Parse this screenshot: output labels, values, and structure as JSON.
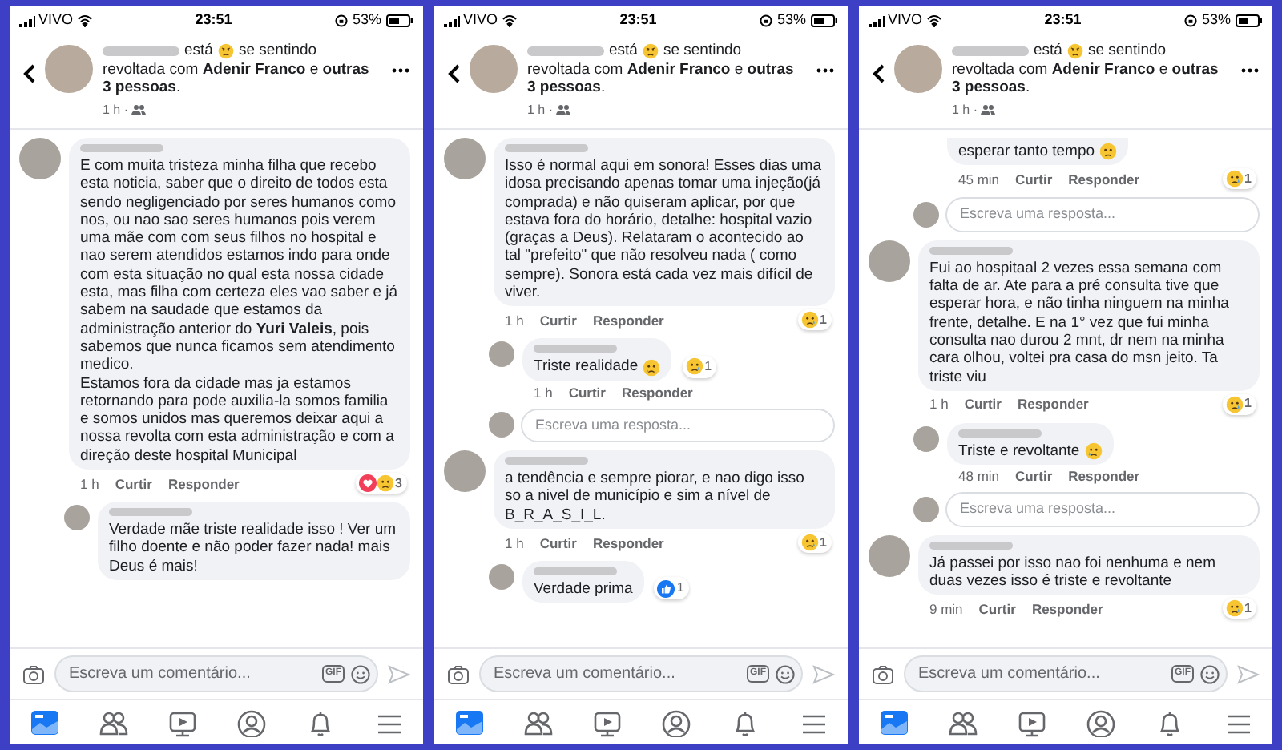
{
  "panels": [
    {
      "status_bar": {
        "carrier": "VIVO",
        "time": "23:51",
        "battery": "53%"
      },
      "post_header": {
        "status": "está",
        "feeling_start": "se sentindo",
        "feeling": "revoltada com **Adenir Franco** e **outras 3 pessoas**.",
        "time": "1 h ·"
      },
      "comments": [
        {
          "kind": "comment",
          "text": "E com muita tristeza minha filha que recebo esta noticia, saber que o direito de todos esta sendo negligenciado por seres humanos  como nos, ou nao sao seres humanos pois verem uma mãe  com com seus filhos no hospital e nao serem atendidos estamos indo para onde com esta situação no qual esta nossa cidade esta, mas filha com certeza eles vao saber e já sabem  na saudade que estamos  da administração  anterior do **Yuri Valeis**, pois sabemos que nunca ficamos sem atendimento  medico.\nEstamos fora da cidade  mas ja estamos retornando  para pode auxilia-la somos familia e somos unidos mas queremos deixar aqui a nossa revolta com esta administração  e com a direção  deste hospital  Municipal",
          "time": "1 h",
          "like": "Curtir",
          "reply": "Responder",
          "reactions": [
            {
              "kind": "love"
            },
            {
              "kind": "sad"
            }
          ],
          "reaction_count": "3"
        },
        {
          "kind": "reply",
          "text": "Verdade mãe  triste realidade isso ! Ver um filho doente e não poder fazer nada! mais Deus é mais!"
        }
      ],
      "composer": {
        "placeholder": "Escreva um comentário...",
        "gif": "GIF"
      },
      "nav": [
        {
          "kind": "feed",
          "selected": true
        },
        {
          "kind": "friends",
          "selected": false
        },
        {
          "kind": "watch",
          "selected": false
        },
        {
          "kind": "profile",
          "selected": false
        },
        {
          "kind": "bell",
          "selected": false
        },
        {
          "kind": "menu",
          "selected": false
        }
      ]
    },
    {
      "status_bar": {
        "carrier": "VIVO",
        "time": "23:51",
        "battery": "53%"
      },
      "post_header": {
        "status": "está",
        "feeling_start": "se sentindo",
        "feeling": "revoltada com **Adenir Franco** e **outras 3 pessoas**.",
        "time": "1 h ·"
      },
      "comments": [
        {
          "kind": "comment",
          "text": "Isso é normal aqui em sonora! Esses dias uma idosa precisando apenas tomar uma injeção(já comprada) e não quiseram aplicar, por que estava fora do horário, detalhe: hospital vazio (graças a Deus). Relataram o acontecido ao tal \"prefeito\" que não resolveu nada ( como sempre). Sonora está cada vez mais difícil de viver.",
          "time": "1 h",
          "like": "Curtir",
          "reply": "Responder",
          "reactions": [
            {
              "kind": "sad"
            }
          ],
          "reaction_count": "1"
        },
        {
          "kind": "reply",
          "text": "Triste realidade",
          "emoji": {
            "kind": "tearful"
          },
          "time": "1 h",
          "like": "Curtir",
          "reply": "Responder",
          "reactions": [
            {
              "kind": "sad"
            }
          ],
          "reaction_count": "1"
        },
        {
          "kind": "reply_box",
          "placeholder": "Escreva uma resposta..."
        },
        {
          "kind": "comment",
          "text": "a tendência e sempre piorar, e nao digo isso so a nivel de município e sim a nível de B_R_A_S_I_L.",
          "time": "1 h",
          "like": "Curtir",
          "reply": "Responder",
          "reactions": [
            {
              "kind": "sad"
            }
          ],
          "reaction_count": "1"
        },
        {
          "kind": "reply",
          "text": "Verdade prima",
          "reactions": [
            {
              "kind": "like"
            }
          ],
          "reaction_count": "1"
        }
      ],
      "composer": {
        "placeholder": "Escreva um comentário...",
        "gif": "GIF"
      },
      "nav": [
        {
          "kind": "feed",
          "selected": true
        },
        {
          "kind": "friends",
          "selected": false
        },
        {
          "kind": "watch",
          "selected": false
        },
        {
          "kind": "profile",
          "selected": false
        },
        {
          "kind": "bell",
          "selected": false
        },
        {
          "kind": "menu",
          "selected": false
        }
      ]
    },
    {
      "status_bar": {
        "carrier": "VIVO",
        "time": "23:51",
        "battery": "53%"
      },
      "post_header": {
        "status": "está",
        "feeling_start": "se sentindo",
        "feeling": "revoltada com **Adenir Franco** e **outras 3 pessoas**.",
        "time": "1 h ·"
      },
      "comments": [
        {
          "kind": "fragment",
          "text": "esperar tanto tempo",
          "emoji": {
            "kind": "disappointed"
          },
          "time": "45 min",
          "like": "Curtir",
          "reply": "Responder",
          "reactions": [
            {
              "kind": "sad"
            }
          ],
          "reaction_count": "1"
        },
        {
          "kind": "reply_box",
          "placeholder": "Escreva uma resposta..."
        },
        {
          "kind": "comment",
          "text": "Fui ao hospitaal 2 vezes essa semana com falta de ar. Ate para a pré consulta tive que esperar hora, e não tinha ninguem na minha frente, detalhe. E na 1° vez que fui minha consulta nao durou 2 mnt, dr nem na minha cara olhou, voltei pra casa do msn jeito. Ta triste viu",
          "time": "1 h",
          "like": "Curtir",
          "reply": "Responder",
          "reactions": [
            {
              "kind": "sad"
            }
          ],
          "reaction_count": "1"
        },
        {
          "kind": "reply",
          "text": "Triste e revoltante",
          "emoji": {
            "kind": "tearful"
          },
          "time": "48 min",
          "like": "Curtir",
          "reply": "Responder"
        },
        {
          "kind": "reply_box",
          "placeholder": "Escreva uma resposta..."
        },
        {
          "kind": "comment",
          "text": "Já passei por isso nao foi nenhuma e nem duas vezes isso é triste e revoltante",
          "time": "9 min",
          "like": "Curtir",
          "reply": "Responder",
          "reactions": [
            {
              "kind": "sad"
            }
          ],
          "reaction_count": "1"
        }
      ],
      "composer": {
        "placeholder": "Escreva um comentário...",
        "gif": "GIF"
      },
      "nav": [
        {
          "kind": "feed",
          "selected": true
        },
        {
          "kind": "friends",
          "selected": false
        },
        {
          "kind": "watch",
          "selected": false
        },
        {
          "kind": "profile",
          "selected": false
        },
        {
          "kind": "bell",
          "selected": false
        },
        {
          "kind": "menu",
          "selected": false
        }
      ]
    }
  ]
}
